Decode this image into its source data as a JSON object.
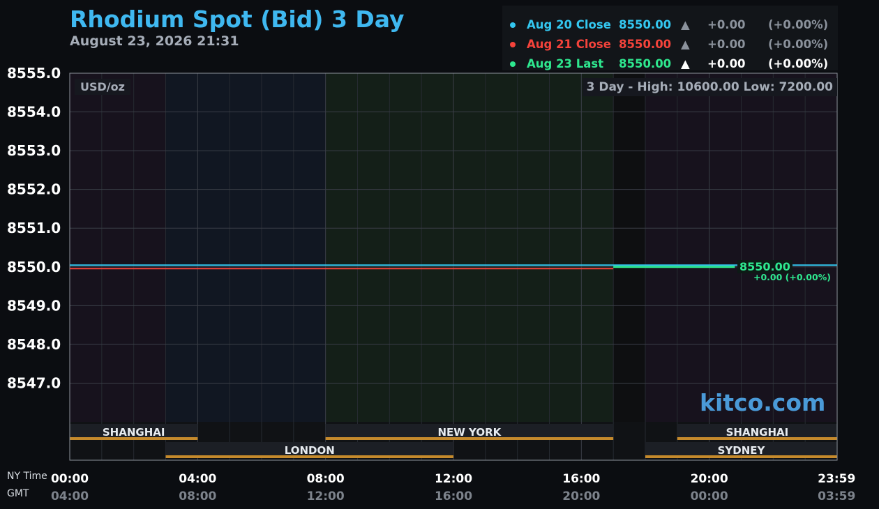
{
  "header": {
    "title": "Rhodium Spot (Bid) 3 Day",
    "subtitle": "August 23, 2026 21:31"
  },
  "legend": [
    {
      "label": "Aug 20 Close",
      "value": "8550.00",
      "arrow": "▲",
      "change": "+0.00",
      "pct": "(+0.00%)",
      "color": "#33c7f0",
      "emphasis": false
    },
    {
      "label": "Aug 21 Close",
      "value": "8550.00",
      "arrow": "▲",
      "change": "+0.00",
      "pct": "(+0.00%)",
      "color": "#f5433b",
      "emphasis": false
    },
    {
      "label": "Aug 23 Last",
      "value": "8550.00",
      "arrow": "▲",
      "change": "+0.00",
      "pct": "(+0.00%)",
      "color": "#2ee88f",
      "emphasis": true
    }
  ],
  "chart_overlay": {
    "unit": "USD/oz",
    "stats": "3 Day - High: 10600.00  Low: 7200.00",
    "last_value": "8550.00",
    "last_change": "+0.00 (+0.00%)",
    "watermark": "kitco.com",
    "ny_time_caption": "NY Time",
    "gmt_caption": "GMT"
  },
  "chart_data": {
    "type": "line",
    "title": "Rhodium Spot (Bid) 3 Day",
    "ylim": [
      8546.0,
      8555.0
    ],
    "y_ticks": [
      8547.0,
      8548.0,
      8549.0,
      8550.0,
      8551.0,
      8552.0,
      8553.0,
      8554.0,
      8555.0
    ],
    "y_tick_labels": [
      "8547.0",
      "8548.0",
      "8549.0",
      "8550.0",
      "8551.0",
      "8552.0",
      "8553.0",
      "8554.0",
      "8555.0"
    ],
    "xlim_hours": [
      0,
      24
    ],
    "x_ticks_hours": [
      0,
      4,
      8,
      12,
      16,
      20,
      23.983
    ],
    "x_tick_labels_ny": [
      "00:00",
      "04:00",
      "08:00",
      "12:00",
      "16:00",
      "20:00",
      "23:59"
    ],
    "x_tick_labels_gmt": [
      "04:00",
      "08:00",
      "12:00",
      "16:00",
      "20:00",
      "00:00",
      "03:59"
    ],
    "grid": true,
    "legend_position": "top-right",
    "series": [
      {
        "name": "Aug 20 Close",
        "color": "#33c7f0",
        "x": [
          0,
          24
        ],
        "y": [
          8550.0,
          8550.0
        ]
      },
      {
        "name": "Aug 21 Close",
        "color": "#f5433b",
        "x": [
          0,
          17
        ],
        "y": [
          8550.0,
          8550.0
        ]
      },
      {
        "name": "Aug 23 Last",
        "color": "#2ee88f",
        "x": [
          17,
          20.8
        ],
        "y": [
          8550.0,
          8550.0
        ]
      }
    ],
    "sessions": [
      {
        "name": "SHANGHAI",
        "start": 0,
        "end": 4,
        "row": 0
      },
      {
        "name": "NEW YORK",
        "start": 8,
        "end": 17,
        "row": 0
      },
      {
        "name": "SHANGHAI",
        "start": 19,
        "end": 24,
        "row": 0
      },
      {
        "name": "LONDON",
        "start": 3,
        "end": 12,
        "row": 1
      },
      {
        "name": "SYDNEY",
        "start": 18,
        "end": 24,
        "row": 1
      }
    ],
    "background_zones": [
      {
        "start": 0,
        "end": 3,
        "color": "#17121d"
      },
      {
        "start": 3,
        "end": 8,
        "color": "#111722"
      },
      {
        "start": 8,
        "end": 17,
        "color": "#141f18"
      },
      {
        "start": 17,
        "end": 18,
        "color": "#0e0f11"
      },
      {
        "start": 18,
        "end": 24,
        "color": "#17121d"
      }
    ]
  }
}
